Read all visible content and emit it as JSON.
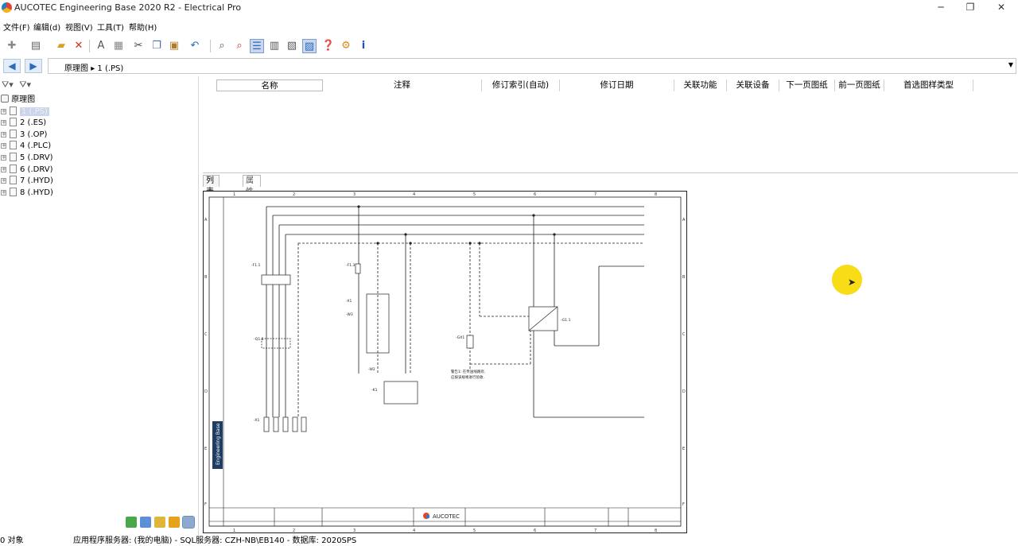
{
  "window": {
    "title": "AUCOTEC  Engineering Base 2020 R2 - Electrical Pro",
    "minimize": "─",
    "restore": "❐",
    "close": "✕"
  },
  "menu": [
    "文件(F)",
    "编辑(d)",
    "视图(V)",
    "工具(T)",
    "帮助(H)"
  ],
  "breadcrumb": {
    "root": "原理图",
    "separator": "▸",
    "current": "1 (.PS)"
  },
  "tree": {
    "root": "原理图",
    "items": [
      "1 (.PS)",
      "2 (.ES)",
      "3 (.OP)",
      "4 (.PLC)",
      "5 (.DRV)",
      "6 (.DRV)",
      "7 (.HYD)",
      "8 (.HYD)"
    ],
    "selected_index": 0
  },
  "columns": [
    "名称",
    "注释",
    "修订索引(自动)",
    "修订日期",
    "关联功能",
    "关联设备",
    "下一页图纸",
    "前一页图纸",
    "首选图样类型"
  ],
  "tabs": [
    "列表窗(L)",
    "属性清单(A)"
  ],
  "schematic": {
    "col_numbers": [
      "1",
      "2",
      "3",
      "4",
      "5",
      "6",
      "7",
      "8"
    ],
    "row_letters": [
      "A",
      "B",
      "C",
      "D",
      "E",
      "F"
    ],
    "brand": "AUCOTEC",
    "side_label": "Engineering Base",
    "tags": {
      "f11": "-F1.1",
      "f13": "-F1.3",
      "q11": "-Q1.1",
      "g11": "-G1.1",
      "x1": "-X1",
      "gx1": "-GX1",
      "w3": "-W3",
      "w2": "-W2",
      "k1": "-K1",
      "x1b": "-X1"
    },
    "note_line1": "警告1: 在传送线路旁,",
    "note_line2": "应按该规格进行验收."
  },
  "status": {
    "count": "0 对象",
    "server": "应用程序服务器: (我的电脑) - SQL服务器: CZH-NB\\EB140 - 数据库: 2020SPS"
  },
  "colors": {
    "accent": "#2e7cc4",
    "cursor_highlight": "#f7dc16",
    "selection": "#c9d6eb"
  }
}
